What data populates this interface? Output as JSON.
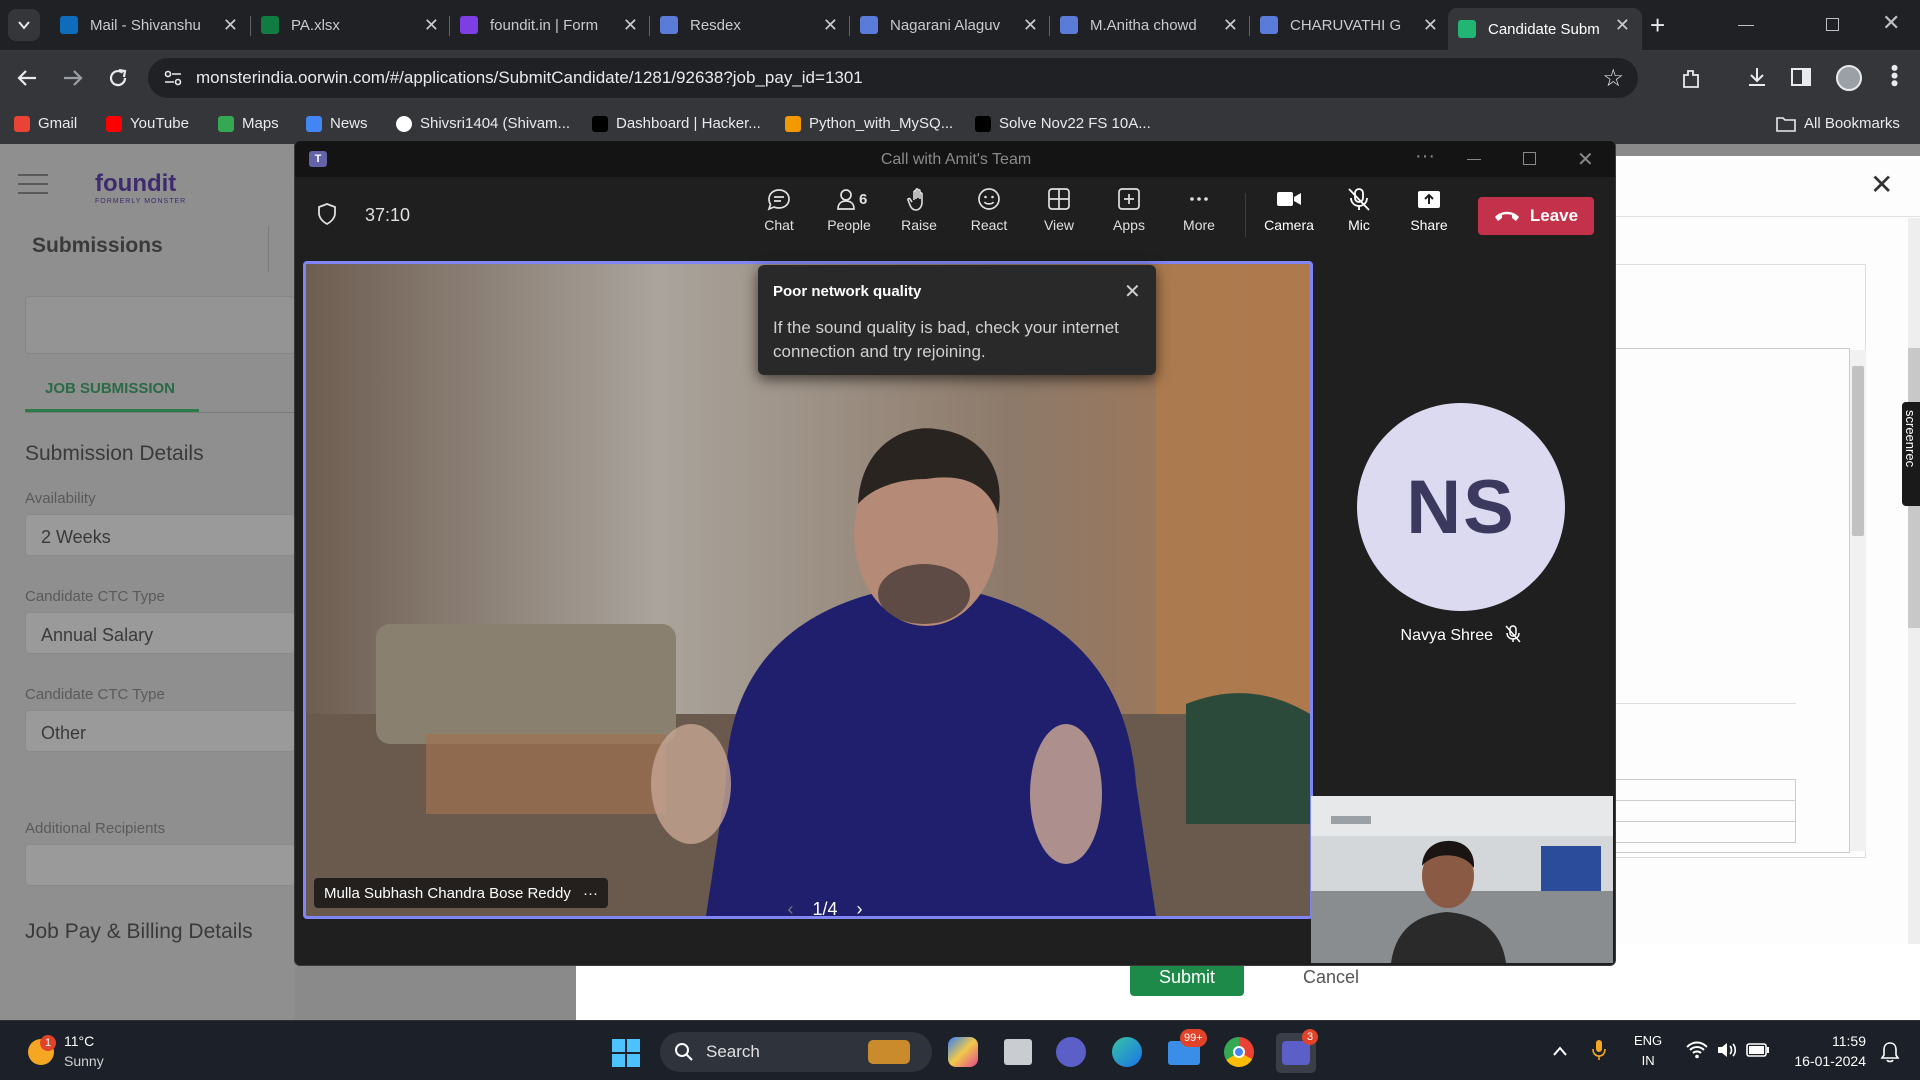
{
  "browser": {
    "tabs": [
      {
        "title": "Mail - Shivanshu",
        "icon": "outlook-icon",
        "color": "#0f6cbd",
        "active": false
      },
      {
        "title": "PA.xlsx",
        "icon": "excel-icon",
        "color": "#107c41",
        "active": false
      },
      {
        "title": "foundit.in | Form",
        "icon": "foundit-icon",
        "color": "#7b3fe4",
        "active": false
      },
      {
        "title": "Resdex",
        "icon": "resdex-icon",
        "color": "#5a7bd8",
        "active": false
      },
      {
        "title": "Nagarani Alaguv",
        "icon": "resdex-icon",
        "color": "#5a7bd8",
        "active": false
      },
      {
        "title": "M.Anitha chowd",
        "icon": "resdex-icon",
        "color": "#5a7bd8",
        "active": false
      },
      {
        "title": "CHARUVATHI G",
        "icon": "resdex-icon",
        "color": "#5a7bd8",
        "active": false
      },
      {
        "title": "Candidate Subm",
        "icon": "oorwin-icon",
        "color": "#22b573",
        "active": true
      }
    ],
    "url": "monsterindia.oorwin.com/#/applications/SubmitCandidate/1281/92638?job_pay_id=1301",
    "bookmarks": [
      {
        "label": "Gmail",
        "icon": "gmail-icon",
        "color": "#ea4335"
      },
      {
        "label": "YouTube",
        "icon": "youtube-icon",
        "color": "#ff0000"
      },
      {
        "label": "Maps",
        "icon": "maps-icon",
        "color": "#34a853"
      },
      {
        "label": "News",
        "icon": "news-icon",
        "color": "#4285f4"
      },
      {
        "label": "Shivsri1404 (Shivam...",
        "icon": "github-icon",
        "color": "#ffffff"
      },
      {
        "label": "Dashboard | Hacker...",
        "icon": "hackerrank-icon",
        "color": "#000000"
      },
      {
        "label": "Python_with_MySQ...",
        "icon": "bookmark-file-icon",
        "color": "#f29900"
      },
      {
        "label": "Solve Nov22 FS 10A...",
        "icon": "hackerrank-icon",
        "color": "#000000"
      }
    ],
    "all_bookmarks": "All Bookmarks"
  },
  "app": {
    "logo": "foundit",
    "logo_sub": "FORMERLY MONSTER",
    "section_title": "Submissions",
    "tab_label": "JOB SUBMISSION",
    "details_title": "Submission Details",
    "fields": [
      {
        "label": "Availability",
        "value": "2 Weeks"
      },
      {
        "label": "Candidate CTC Type",
        "value": "Annual Salary"
      },
      {
        "label": "Candidate CTC Type",
        "value": "Other"
      },
      {
        "label": "Additional Recipients",
        "value": ""
      }
    ],
    "billing_title": "Job Pay & Billing Details",
    "submit_label": "Submit",
    "cancel_label": "Cancel"
  },
  "teams": {
    "window_title": "Call with Amit's Team",
    "timer": "37:10",
    "toolbar": [
      {
        "label": "Chat",
        "icon": "chat-icon"
      },
      {
        "label": "People",
        "icon": "people-icon",
        "count": "6"
      },
      {
        "label": "Raise",
        "icon": "raise-hand-icon"
      },
      {
        "label": "React",
        "icon": "react-icon"
      },
      {
        "label": "View",
        "icon": "view-icon"
      },
      {
        "label": "Apps",
        "icon": "apps-icon"
      },
      {
        "label": "More",
        "icon": "more-icon"
      },
      {
        "label": "Camera",
        "icon": "camera-icon"
      },
      {
        "label": "Mic",
        "icon": "mic-off-icon"
      },
      {
        "label": "Share",
        "icon": "share-icon"
      }
    ],
    "leave_label": "Leave",
    "toast": {
      "title": "Poor network quality",
      "message": "If the sound quality is bad, check your internet connection and try rejoining."
    },
    "main_participant": "Mulla Subhash Chandra Bose Reddy",
    "side_participant": {
      "initials": "NS",
      "name": "Navya Shree"
    },
    "pagination": "1/4",
    "accent": "#7f85f5",
    "leave_color": "#c4314b"
  },
  "screenrec": "screenrec",
  "taskbar": {
    "weather_temp": "11°C",
    "weather_desc": "Sunny",
    "weather_badge": "1",
    "search_label": "Search",
    "mail_badge": "99+",
    "teams_badge": "3",
    "lang": "ENG",
    "region": "IN",
    "time": "11:59",
    "date": "16-01-2024"
  }
}
